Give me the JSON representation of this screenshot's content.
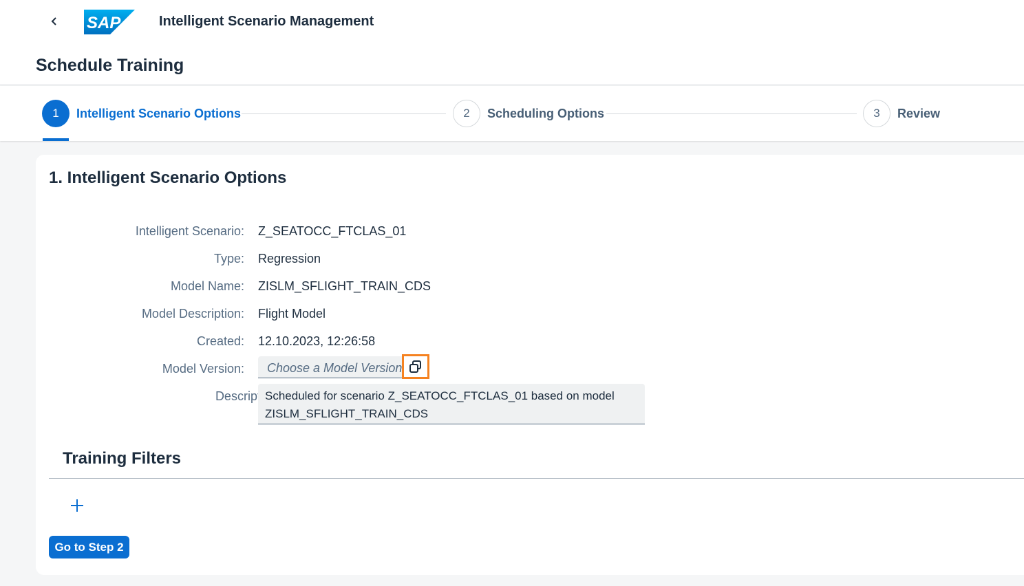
{
  "shell": {
    "back_icon": "chevron-left-icon",
    "logo_text": "SAP",
    "brand_color": "#0a6ed1",
    "app_title": "Intelligent Scenario Management"
  },
  "header": {
    "page_title": "Schedule Training"
  },
  "wizard": {
    "steps": [
      {
        "number": "1",
        "label": "Intelligent Scenario Options",
        "state": "active"
      },
      {
        "number": "2",
        "label": "Scheduling Options",
        "state": "inactive"
      },
      {
        "number": "3",
        "label": "Review",
        "state": "inactive"
      }
    ]
  },
  "section": {
    "title": "1. Intelligent Scenario Options",
    "fields": {
      "scenario": {
        "label": "Intelligent Scenario:",
        "value": "Z_SEATOCC_FTCLAS_01"
      },
      "type": {
        "label": "Type:",
        "value": "Regression"
      },
      "model_name": {
        "label": "Model Name:",
        "value": "ZISLM_SFLIGHT_TRAIN_CDS"
      },
      "model_description": {
        "label": "Model Description:",
        "value": "Flight Model"
      },
      "created": {
        "label": "Created:",
        "value": "12.10.2023, 12:26:58"
      },
      "model_version": {
        "label": "Model Version:",
        "placeholder": "Choose a Model Version",
        "value_help_icon": "value-help-icon"
      },
      "description": {
        "label": "Description:",
        "required_marker": "*",
        "value": "Scheduled for scenario Z_SEATOCC_FTCLAS_01 based on model ZISLM_SFLIGHT_TRAIN_CDS"
      }
    },
    "highlight_color": "#f58220"
  },
  "training_filters": {
    "title": "Training Filters",
    "add_icon": "plus-icon"
  },
  "footer": {
    "next_label": "Go to Step 2"
  }
}
